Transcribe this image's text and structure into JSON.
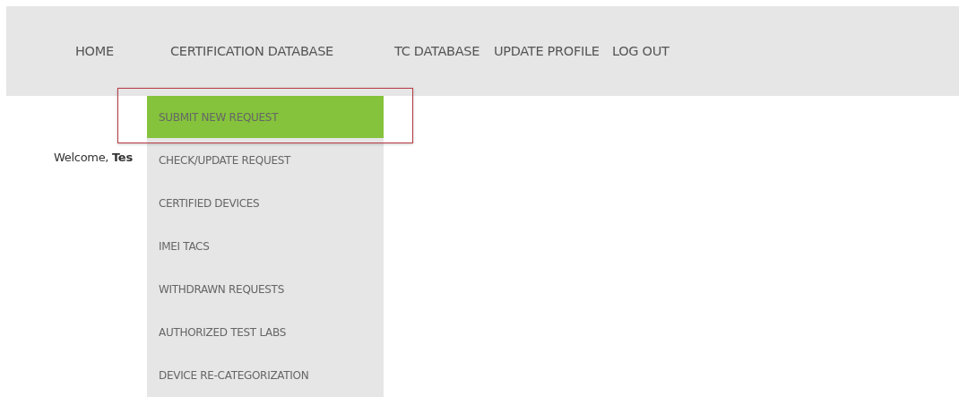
{
  "nav": [
    {
      "label": "HOME",
      "expanded": false
    },
    {
      "label": "CERTIFICATION DATABASE",
      "expanded": true
    },
    {
      "label": "TC DATABASE",
      "expanded": false
    },
    {
      "label": "UPDATE PROFILE",
      "expanded": false
    },
    {
      "label": "LOG OUT",
      "expanded": false
    }
  ],
  "dropdown": [
    {
      "label": "SUBMIT NEW REQUEST",
      "selected": true
    },
    {
      "label": "CHECK/UPDATE REQUEST",
      "selected": false
    },
    {
      "label": "CERTIFIED DEVICES",
      "selected": false
    },
    {
      "label": "IMEI TACS",
      "selected": false
    },
    {
      "label": "WITHDRAWN REQUESTS",
      "selected": false
    },
    {
      "label": "AUTHORIZED TEST LABS",
      "selected": false
    },
    {
      "label": "DEVICE RE-CATEGORIZATION",
      "selected": false
    }
  ],
  "welcome": "Welcome, **Tes**"
}
